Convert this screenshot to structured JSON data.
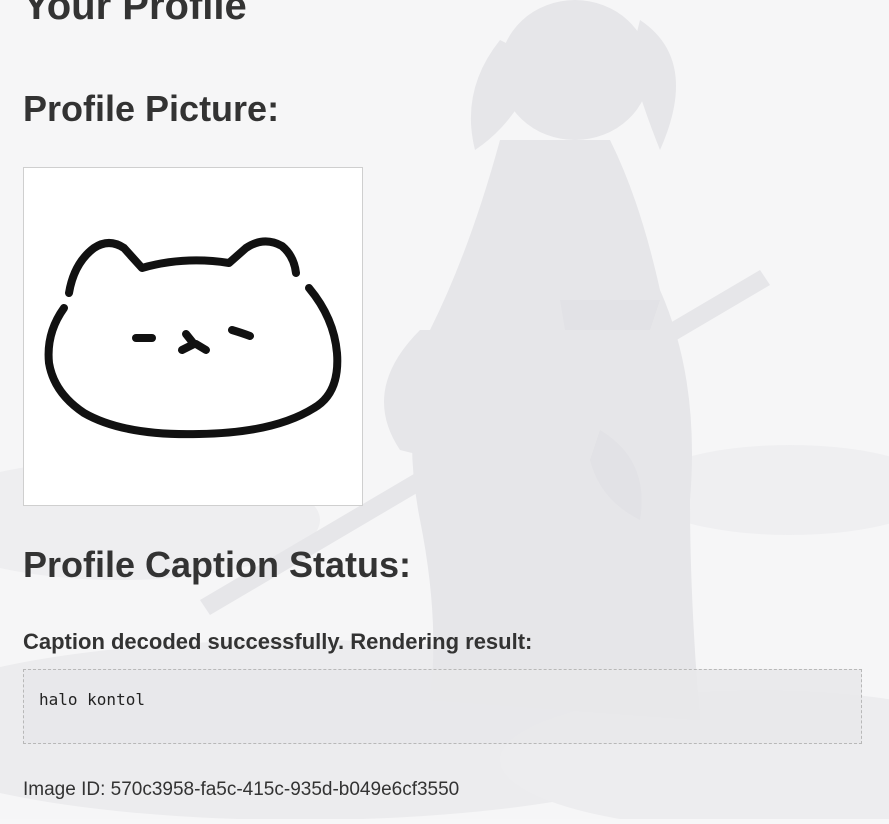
{
  "page": {
    "title": "Your Profile"
  },
  "profile_picture": {
    "heading": "Profile Picture:"
  },
  "caption_status": {
    "heading": "Profile Caption Status:",
    "status_message": "Caption decoded successfully. Rendering result:",
    "caption_text": "halo kontol"
  },
  "image_id": {
    "text": "Image ID: 570c3958-fa5c-415c-935d-b049e6cf3550"
  },
  "colors": {
    "heading_text": "#333333",
    "page_background": "#f7f7f8",
    "caption_box_background": "#e8e8ea"
  },
  "icons": {
    "profile_picture": "cat-face-drawing"
  }
}
